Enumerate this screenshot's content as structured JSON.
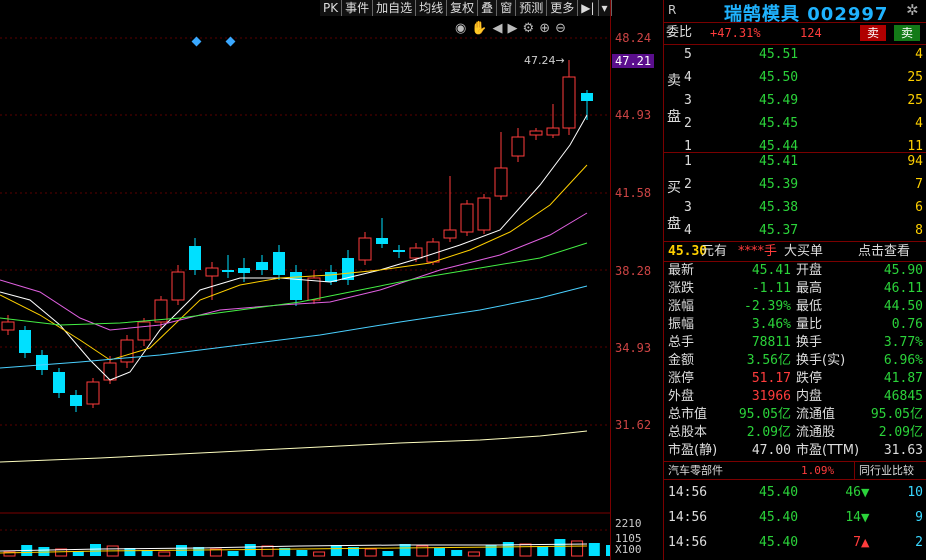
{
  "toolbar": {
    "items": [
      "PK",
      "事件",
      "加自选",
      "均线",
      "复权",
      "叠",
      "窗",
      "预测",
      "更多"
    ]
  },
  "axis": {
    "prices": [
      "48.24",
      "47.21",
      "44.93",
      "41.58",
      "38.28",
      "34.93",
      "31.62"
    ],
    "volume": [
      "2210",
      "1105",
      "X100"
    ]
  },
  "chart": {
    "high_label": "47.24"
  },
  "header": {
    "name": "瑞鹄模具 002997"
  },
  "commission": {
    "label": "委比",
    "ratio": "+47.31%",
    "diff": "124",
    "sell_btn": "卖",
    "buy_btn": "卖"
  },
  "ask": {
    "side_chars": [
      "卖",
      "盘"
    ],
    "rows": [
      {
        "lvl": "5",
        "price": "45.51",
        "vol": "4"
      },
      {
        "lvl": "4",
        "price": "45.50",
        "vol": "25"
      },
      {
        "lvl": "3",
        "price": "45.49",
        "vol": "25"
      },
      {
        "lvl": "2",
        "price": "45.45",
        "vol": "4"
      },
      {
        "lvl": "1",
        "price": "45.44",
        "vol": "11"
      }
    ]
  },
  "bid": {
    "side_chars": [
      "买",
      "盘"
    ],
    "rows": [
      {
        "lvl": "1",
        "price": "45.41",
        "vol": "94"
      },
      {
        "lvl": "2",
        "price": "45.39",
        "vol": "7"
      },
      {
        "lvl": "3",
        "price": "45.38",
        "vol": "6"
      },
      {
        "lvl": "4",
        "price": "45.37",
        "vol": "8"
      }
    ]
  },
  "bigorder": {
    "price": "45.30",
    "unit": "元有",
    "stars": "****手",
    "label": "大买单",
    "link": "点击查看"
  },
  "stats": [
    {
      "l1": "最新",
      "v1": "45.41",
      "c1": "green",
      "l2": "开盘",
      "v2": "45.90",
      "c2": "green"
    },
    {
      "l1": "涨跌",
      "v1": "-1.11",
      "c1": "green",
      "l2": "最高",
      "v2": "46.11",
      "c2": "green"
    },
    {
      "l1": "涨幅",
      "v1": "-2.39%",
      "c1": "green",
      "l2": "最低",
      "v2": "44.50",
      "c2": "green"
    },
    {
      "l1": "振幅",
      "v1": "3.46%",
      "c1": "green",
      "l2": "量比",
      "v2": "0.76",
      "c2": "green"
    },
    {
      "l1": "总手",
      "v1": "78811",
      "c1": "green",
      "l2": "换手",
      "v2": "3.77%",
      "c2": "green"
    },
    {
      "l1": "金额",
      "v1": "3.56亿",
      "c1": "green",
      "l2": "换手(实)",
      "v2": "6.96%",
      "c2": "green"
    },
    {
      "l1": "涨停",
      "v1": "51.17",
      "c1": "red",
      "l2": "跌停",
      "v2": "41.87",
      "c2": "green"
    },
    {
      "l1": "外盘",
      "v1": "31966",
      "c1": "red",
      "l2": "内盘",
      "v2": "46845",
      "c2": "green"
    },
    {
      "l1": "总市值",
      "v1": "95.05亿",
      "c1": "green",
      "l2": "流通值",
      "v2": "95.05亿",
      "c2": "green"
    },
    {
      "l1": "总股本",
      "v1": "2.09亿",
      "c1": "green",
      "l2": "流通股",
      "v2": "2.09亿",
      "c2": "green"
    },
    {
      "l1": "市盈(静)",
      "v1": "47.00",
      "c1": "white",
      "l2": "市盈(TTM)",
      "v2": "31.63",
      "c2": "white"
    }
  ],
  "sector": {
    "name": "汽车零部件",
    "change": "1.09%",
    "compare": "同行业比较"
  },
  "ticks": [
    {
      "time": "14:56",
      "price": "45.40",
      "vol": "46",
      "dir": "down",
      "n": "10"
    },
    {
      "time": "14:56",
      "price": "45.40",
      "vol": "14",
      "dir": "down",
      "n": "9"
    },
    {
      "time": "14:56",
      "price": "45.40",
      "vol": "7",
      "dir": "up",
      "n": "2"
    }
  ],
  "colors": {
    "up": "#ff3c3c",
    "down": "#00e0ff",
    "border": "#7a0000"
  }
}
